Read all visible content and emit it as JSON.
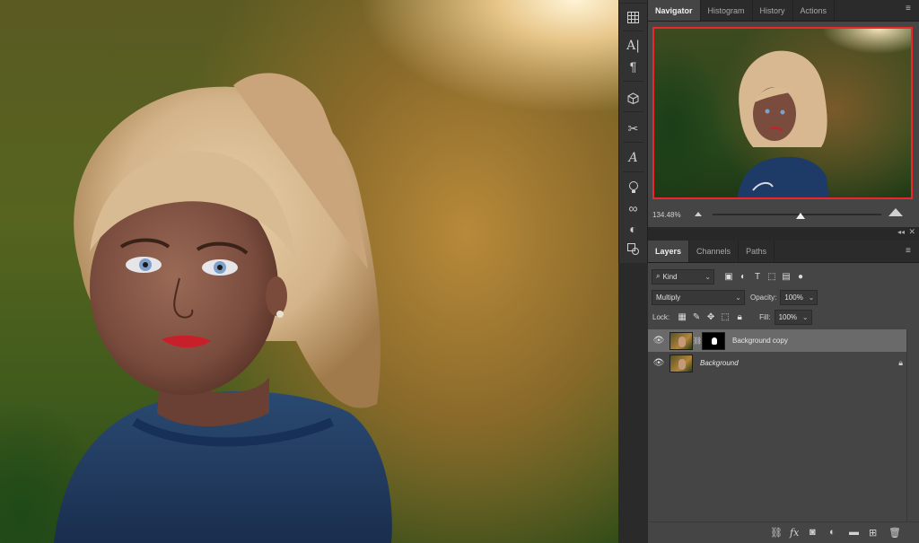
{
  "navigator_tabs": [
    {
      "label": "Navigator",
      "active": true
    },
    {
      "label": "Histogram",
      "active": false
    },
    {
      "label": "History",
      "active": false
    },
    {
      "label": "Actions",
      "active": false
    }
  ],
  "navigator": {
    "zoom": "134.48%",
    "zoom_slider_fraction": 0.52,
    "view_box_color": "#e8282c"
  },
  "layers_tabs": [
    {
      "label": "Layers",
      "active": true
    },
    {
      "label": "Channels",
      "active": false
    },
    {
      "label": "Paths",
      "active": false
    }
  ],
  "layers": {
    "filter_kind": "Kind",
    "blend_mode": "Multiply",
    "opacity_label": "Opacity:",
    "opacity_value": "100%",
    "lock_label": "Lock:",
    "fill_label": "Fill:",
    "fill_value": "100%",
    "items": [
      {
        "name": "Background copy",
        "visible": true,
        "selected": true,
        "has_mask": true,
        "locked": false
      },
      {
        "name": "Background",
        "visible": true,
        "selected": false,
        "has_mask": false,
        "locked": true
      }
    ]
  },
  "toolstrip_icons": [
    "grid-icon",
    "character-icon",
    "paragraph-icon",
    "3d-cube-icon",
    "tool-presets-icon",
    "glyphs-icon",
    "lightbulb-icon",
    "creative-cloud-icon",
    "adjustments-icon",
    "clone-source-icon"
  ],
  "footer_icons": [
    "link-icon",
    "fx-icon",
    "add-mask-icon",
    "adjustment-layer-icon",
    "group-icon",
    "new-layer-icon",
    "delete-icon"
  ]
}
